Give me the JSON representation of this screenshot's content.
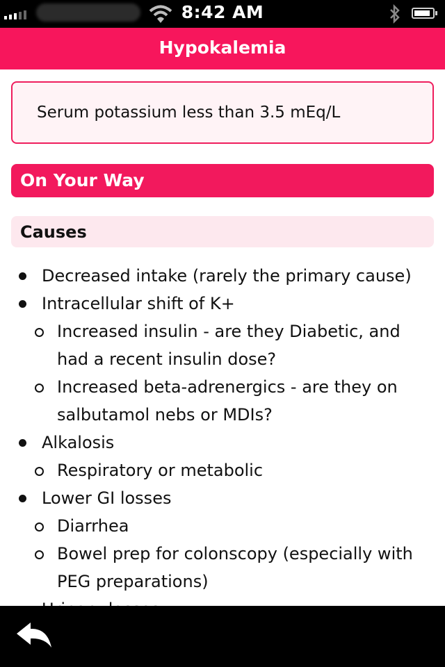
{
  "status_bar": {
    "time": "8:42 AM"
  },
  "header": {
    "title": "Hypokalemia"
  },
  "definition": "Serum potassium less than 3.5 mEq/L",
  "section": {
    "title": "On Your Way"
  },
  "subsection": {
    "title": "Causes"
  },
  "list": {
    "r0": "Decreased intake (rarely the primary cause)",
    "r1": "Intracellular shift of K+",
    "r2": "Increased insulin - are they Diabetic, and",
    "r3": "had a recent insulin dose?",
    "r4": "Increased beta-adrenergics - are they on",
    "r5": "salbutamol nebs or MDIs?",
    "r6": "Alkalosis",
    "r7": "Respiratory or metabolic",
    "r8": "Lower GI losses",
    "r9": "Diarrhea",
    "r10": "Bowel prep for colonscopy (especially with",
    "r11": "PEG preparations)",
    "r12": "Urinary losses"
  },
  "toolbar": {
    "back_icon": "back-arrow-icon"
  },
  "colors": {
    "accent": "#f7165c",
    "subheader_bg": "#fde8ee",
    "definition_bg": "#fff3f6"
  }
}
